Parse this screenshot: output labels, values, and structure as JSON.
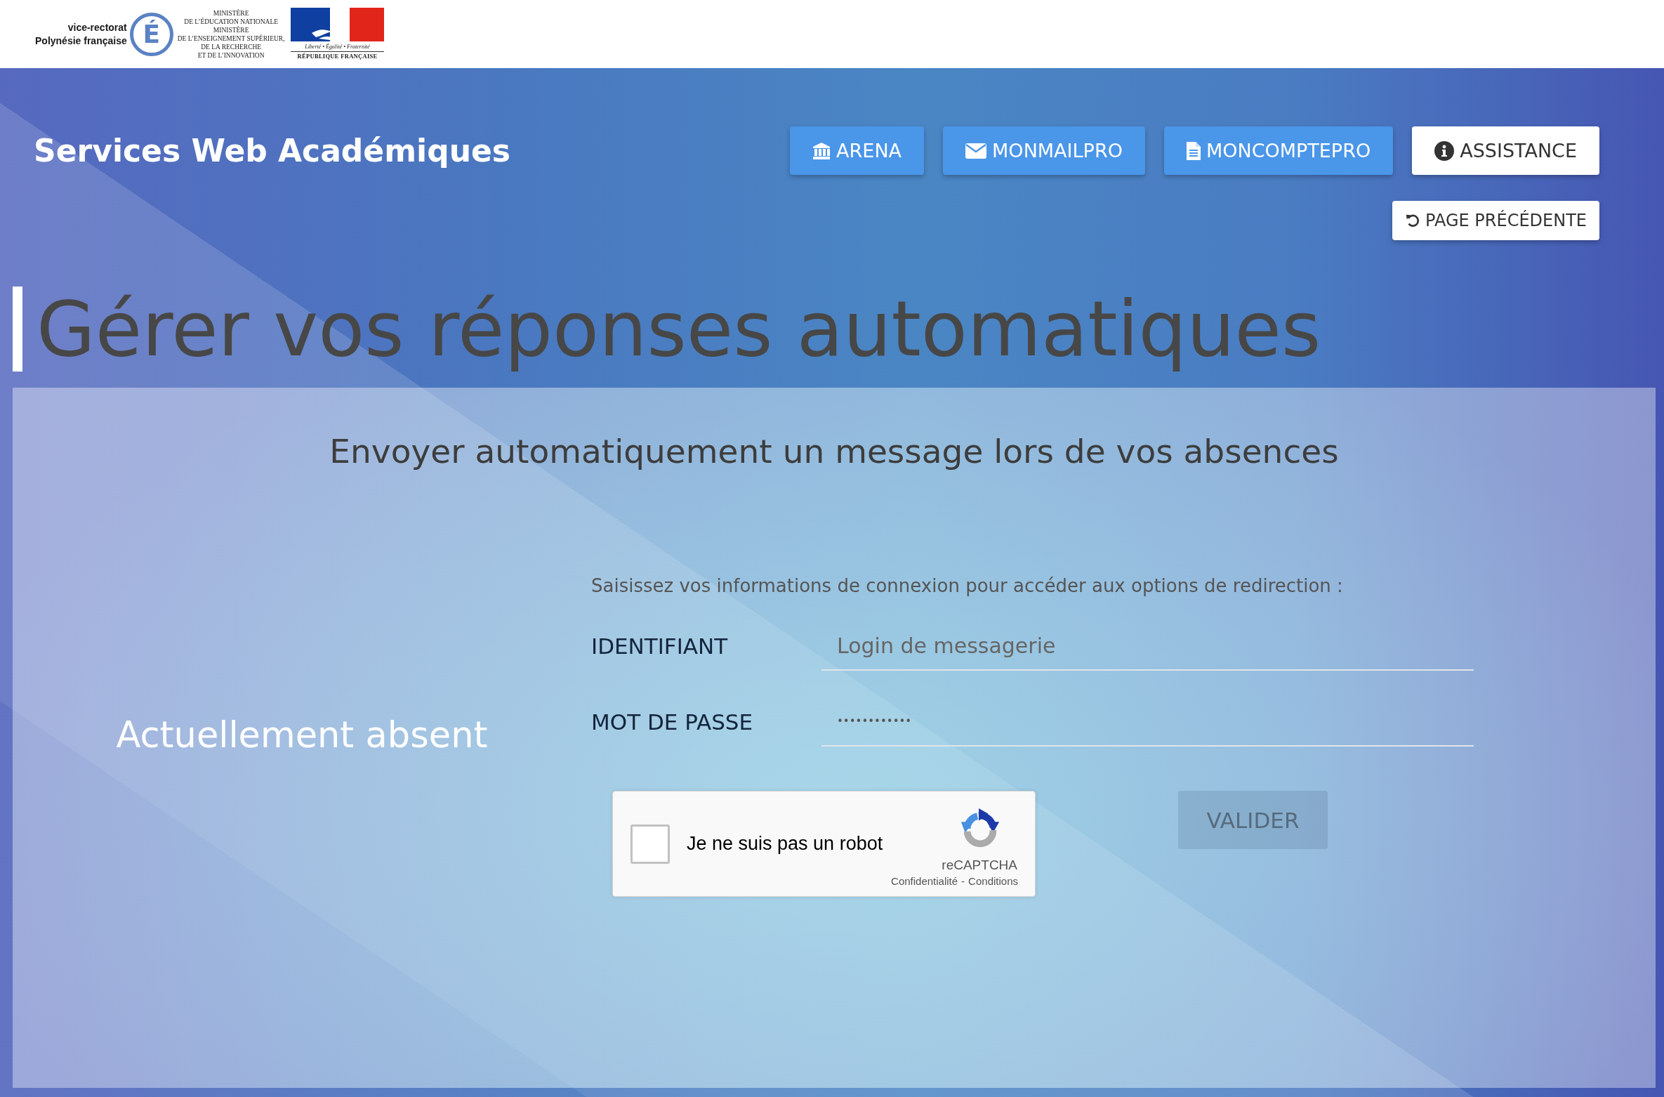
{
  "header": {
    "rectorat_logo": {
      "lines": [
        "vice-rectorat",
        "Polynésie française"
      ],
      "mark": "É"
    },
    "ministry_logo": {
      "lines": [
        "MINISTÈRE",
        "DE L’ÉDUCATION NATIONALE",
        "MINISTÈRE",
        "DE L’ENSEIGNEMENT SUPÉRIEUR,",
        "DE LA RECHERCHE",
        "ET DE L’INNOVATION"
      ]
    },
    "republic_logo": {
      "motto": "Liberté • Égalité • Fraternité",
      "name": "RÉPUBLIQUE FRANÇAISE"
    }
  },
  "top_bar": {
    "site_title": "Services Web Académiques",
    "nav_buttons": [
      {
        "label": "ARENA",
        "kind": "primary"
      },
      {
        "label": "MONMAILPRO",
        "kind": "primary"
      },
      {
        "label": "MONCOMPTEPRO",
        "kind": "primary"
      },
      {
        "label": "ASSISTANCE",
        "kind": "default"
      }
    ],
    "back_button": {
      "label": "PAGE PRÉCÉDENTE"
    }
  },
  "page_title": "Gérer vos réponses automatiques",
  "panel": {
    "subtitle": "Envoyer automatiquement un message lors de vos absences",
    "status": "Actuellement absent",
    "form": {
      "intro": "Saisissez vos informations de connexion pour accéder aux options de redirection :",
      "fields": [
        {
          "label": "IDENTIFIANT",
          "kind": "text",
          "placeholder": "Login de messagerie"
        },
        {
          "label": "MOT DE PASSE",
          "kind": "password",
          "value": "••••••••••••"
        }
      ],
      "recaptcha": {
        "label": "Je ne suis pas un robot",
        "checked": false,
        "brand": "reCAPTCHA",
        "links": [
          "Confidentialité",
          "Conditions"
        ],
        "separator": "-"
      },
      "submit": {
        "label": "VALIDER",
        "disabled": true
      }
    }
  }
}
